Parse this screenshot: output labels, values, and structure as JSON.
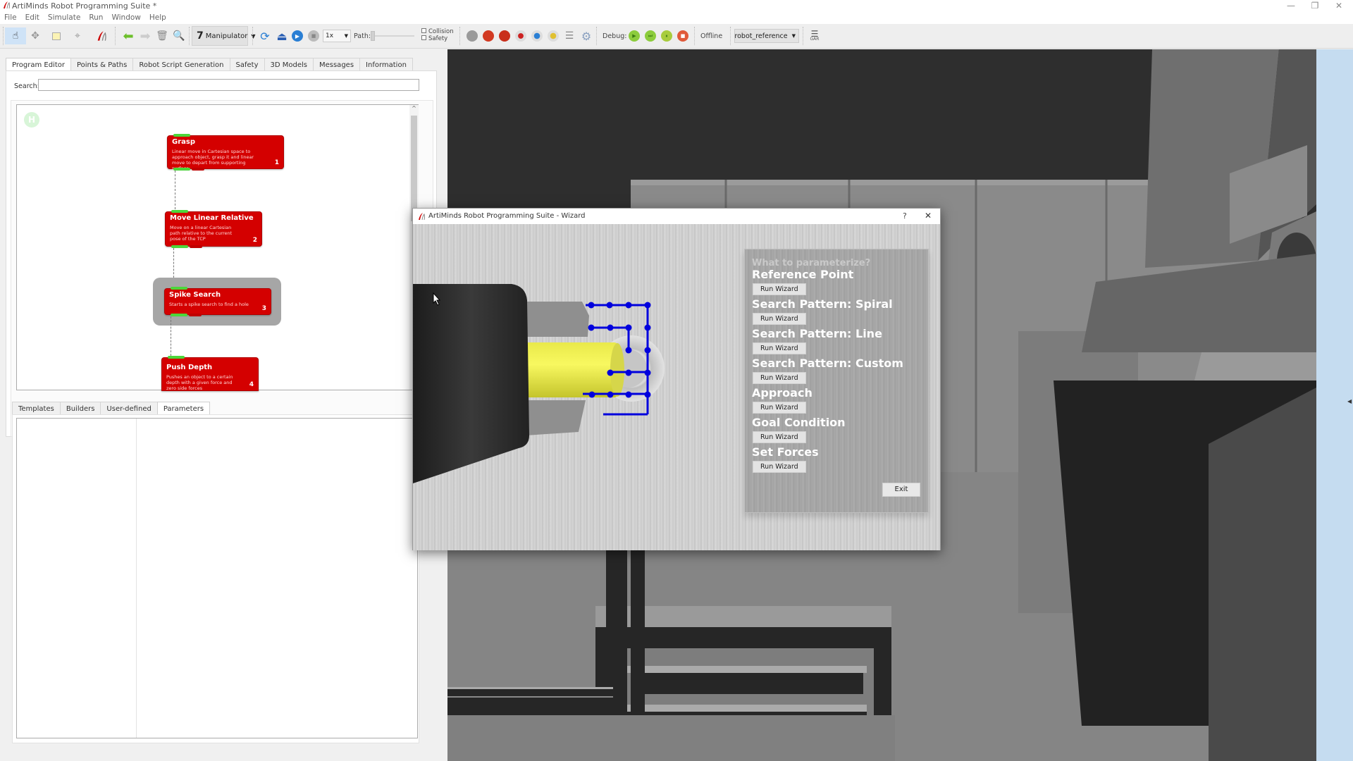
{
  "app": {
    "title": "ArtiMinds Robot Programming Suite *",
    "window_controls": {
      "minimize": "—",
      "restore": "❐",
      "close": "✕"
    }
  },
  "menu": [
    "File",
    "Edit",
    "Simulate",
    "Run",
    "Window",
    "Help"
  ],
  "toolbar": {
    "tools": [
      "pointer-tool",
      "move-tool",
      "select-rect-tool",
      "target-tool",
      "artiminds-tool"
    ],
    "nav": [
      "back-arrow",
      "forward-arrow",
      "trash",
      "zoom-search"
    ],
    "manipulator_label": "Manipulator",
    "speed_value": "1x",
    "path_label": "Path:",
    "path_progress": 0,
    "collision_label": "Collision",
    "safety_label": "Safety",
    "collision_checked": false,
    "safety_checked": false,
    "debug_label": "Debug:",
    "status_label": "Offline",
    "reference_value": "robot_reference",
    "extra_label": "GAR"
  },
  "left_tabs": [
    {
      "label": "Program Editor",
      "active": true
    },
    {
      "label": "Points & Paths",
      "active": false
    },
    {
      "label": "Robot Script Generation",
      "active": false
    },
    {
      "label": "Safety",
      "active": false
    },
    {
      "label": "3D Models",
      "active": false
    },
    {
      "label": "Messages",
      "active": false
    },
    {
      "label": "Information",
      "active": false
    }
  ],
  "search": {
    "label": "Search:",
    "value": "",
    "placeholder": ""
  },
  "program": {
    "home_badge": "H",
    "blocks": [
      {
        "title": "Grasp",
        "desc": "Linear move in Cartesian space to approach object, grasp it and linear move to depart from supporting surface",
        "num": "1",
        "selected": false
      },
      {
        "title": "Move Linear Relative",
        "desc": "Move on a linear Cartesian path relative to the current pose of the TCP",
        "num": "2",
        "selected": false
      },
      {
        "title": "Spike Search",
        "desc": "Starts a spike search to find a hole",
        "num": "3",
        "selected": true
      },
      {
        "title": "Push Depth",
        "desc": "Pushes an object to a certain depth with a given force and zero side forces",
        "num": "4",
        "selected": false
      }
    ]
  },
  "bottom_tabs": [
    {
      "label": "Templates",
      "active": false
    },
    {
      "label": "Builders",
      "active": false
    },
    {
      "label": "User-defined",
      "active": false
    },
    {
      "label": "Parameters",
      "active": true
    }
  ],
  "wizard": {
    "title": "ArtiMinds Robot Programming Suite - Wizard",
    "help": "?",
    "close": "✕",
    "question": "What to parameterize?",
    "sections": [
      {
        "heading": "Reference Point",
        "button": "Run Wizard"
      },
      {
        "heading": "Search Pattern: Spiral",
        "button": "Run Wizard"
      },
      {
        "heading": "Search Pattern: Line",
        "button": "Run Wizard"
      },
      {
        "heading": "Search Pattern: Custom",
        "button": "Run Wizard"
      },
      {
        "heading": "Approach",
        "button": "Run Wizard"
      },
      {
        "heading": "Goal Condition",
        "button": "Run Wizard"
      },
      {
        "heading": "Set Forces",
        "button": "Run Wizard"
      }
    ],
    "exit_label": "Exit",
    "search_path_color": "#0000dd",
    "peg_color": "#f2f23a"
  },
  "colors": {
    "block_red": "#d40000",
    "connector_green": "#4cd63a",
    "viewport_bg": "#2e2e2e",
    "side_strip": "#c5dcf0"
  }
}
